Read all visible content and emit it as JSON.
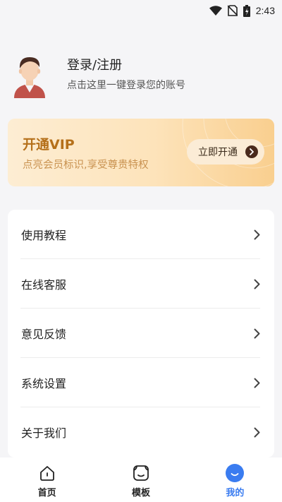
{
  "status_bar": {
    "time": "2:43"
  },
  "profile": {
    "title": "登录/注册",
    "subtitle": "点击这里一键登录您的账号"
  },
  "vip": {
    "title": "开通VIP",
    "subtitle": "点亮会员标识,享受尊贵特权",
    "button_label": "立即开通"
  },
  "menu": [
    {
      "label": "使用教程"
    },
    {
      "label": "在线客服"
    },
    {
      "label": "意见反馈"
    },
    {
      "label": "系统设置"
    },
    {
      "label": "关于我们"
    }
  ],
  "tabs": [
    {
      "label": "首页",
      "icon": "home-icon",
      "active": false
    },
    {
      "label": "模板",
      "icon": "template-icon",
      "active": false
    },
    {
      "label": "我的",
      "icon": "profile-smile-icon",
      "active": true
    }
  ],
  "colors": {
    "accent": "#3a7cf0",
    "vip_gold": "#b5701a",
    "vip_button_bg": "#fbecd6"
  }
}
